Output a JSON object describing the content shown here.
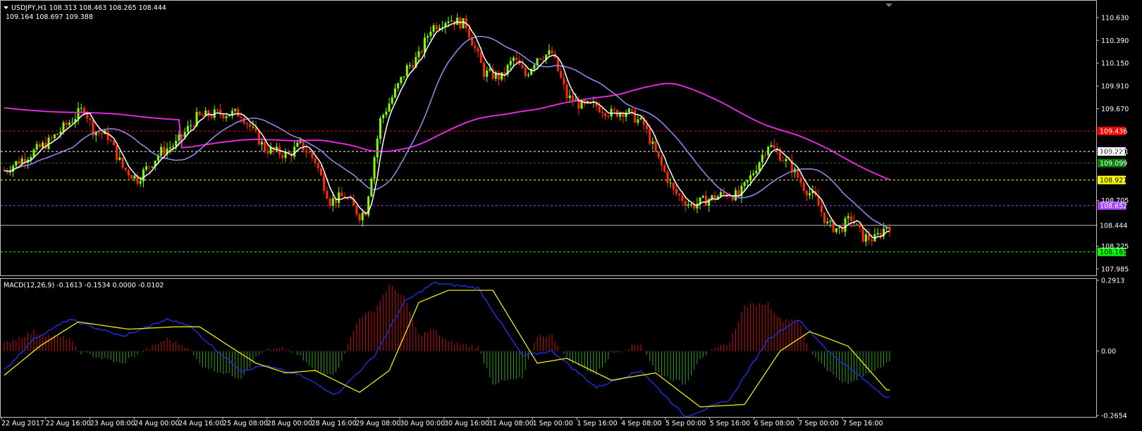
{
  "header": {
    "symbol_line": "USDJPY,H1  108.313 108.463 108.265 108.444",
    "ma_line": "109.164 108.697 109.388",
    "macd_label": "MACD(12,26,9) -0.1613 -0.1534 0.0000 -0.0102"
  },
  "colors": {
    "background": "#000000",
    "bull": "#7fff00",
    "bear": "#ff2a00",
    "white_ma": "#ffffff",
    "slow_ma": "#9a8cf0",
    "magenta_ma": "#e02ad6",
    "macd_line": "#1e2ed8",
    "signal_line": "#ffff00",
    "hist_pos": "#c81010",
    "hist_neg": "#2fa01a"
  },
  "chart_data": [
    {
      "type": "candlestick",
      "title": "USDJPY,H1",
      "ylim": [
        107.94,
        110.77
      ],
      "y_ticks": [
        "110.630",
        "110.390",
        "110.150",
        "109.910",
        "109.670",
        "109.221",
        "108.705",
        "108.444",
        "108.225",
        "107.985"
      ],
      "y_tick_values": [
        110.63,
        110.39,
        110.15,
        109.91,
        109.67,
        109.221,
        108.705,
        108.444,
        108.225,
        107.985
      ],
      "x_ticks": [
        "22 Aug 2017",
        "22 Aug 16:00",
        "23 Aug 08:00",
        "24 Aug 00:00",
        "24 Aug 16:00",
        "25 Aug 08:00",
        "28 Aug 00:00",
        "28 Aug 16:00",
        "29 Aug 08:00",
        "30 Aug 00:00",
        "30 Aug 16:00",
        "31 Aug 08:00",
        "1 Sep 00:00",
        "1 Sep 16:00",
        "4 Sep 08:00",
        "5 Sep 00:00",
        "5 Sep 16:00",
        "6 Sep 08:00",
        "7 Sep 00:00",
        "7 Sep 16:00"
      ],
      "price_path": {
        "candle_index": [
          0,
          15,
          27,
          30,
          35,
          40,
          45,
          53,
          58,
          65,
          72,
          80,
          88,
          96,
          100,
          105,
          110,
          115,
          120,
          122,
          127,
          132,
          136,
          140,
          144,
          150,
          156,
          162,
          168,
          172,
          176,
          180,
          185,
          190,
          195,
          200,
          205,
          210,
          216,
          220,
          226,
          232,
          238,
          244,
          248,
          252,
          258,
          262,
          266,
          270,
          274,
          278,
          282,
          286,
          290,
          294,
          298
        ],
        "close": [
          109.02,
          109.32,
          109.68,
          109.45,
          109.38,
          109.05,
          108.93,
          109.22,
          109.3,
          109.58,
          109.62,
          109.62,
          109.25,
          109.18,
          109.3,
          109.12,
          108.7,
          108.75,
          108.55,
          108.6,
          109.55,
          109.85,
          110.1,
          110.22,
          110.52,
          110.62,
          110.55,
          110.05,
          110.0,
          110.2,
          110.02,
          110.22,
          110.25,
          109.8,
          109.7,
          109.7,
          109.62,
          109.65,
          109.5,
          109.2,
          108.8,
          108.65,
          108.72,
          108.78,
          108.75,
          108.95,
          109.3,
          109.18,
          109.05,
          108.85,
          108.72,
          108.45,
          108.4,
          108.52,
          108.32,
          108.3,
          108.44
        ]
      },
      "horizontal_lines": [
        {
          "label": "109.436",
          "value": 109.436,
          "color": "#ff0000",
          "style": "dashed"
        },
        {
          "label": "109.221",
          "value": 109.221,
          "color": "#ffffff",
          "style": "dashed"
        },
        {
          "label": "109.099",
          "value": 109.099,
          "color": "#008000",
          "style": "dashed"
        },
        {
          "label": "108.921",
          "value": 108.921,
          "color": "#ffff00",
          "style": "dashed"
        },
        {
          "label": "108.652",
          "value": 108.652,
          "color": "#a040ff",
          "style": "dashed"
        },
        {
          "label": "108.444",
          "value": 108.444,
          "color": "#c0c0c0",
          "style": "solid"
        },
        {
          "label": "108.165",
          "value": 108.165,
          "color": "#00ff00",
          "style": "dashed"
        }
      ],
      "moving_averages": [
        "white fast MA",
        "lavender slow MA",
        "magenta long MA"
      ]
    },
    {
      "type": "macd_histogram",
      "title": "MACD(12,26,9)",
      "ylim": [
        -0.2654,
        0.2913
      ],
      "y_ticks": [
        "0.2913",
        "0.00",
        "-0.2654"
      ],
      "y_tick_values": [
        0.2913,
        0.0,
        -0.2654
      ],
      "series": [
        {
          "name": "MACD",
          "anchor_index": [
            0,
            10,
            22,
            40,
            55,
            62,
            72,
            80,
            88,
            100,
            112,
            125,
            135,
            145,
            160,
            175,
            185,
            200,
            215,
            230,
            245,
            258,
            268,
            280,
            298
          ],
          "values": [
            -0.08,
            0.05,
            0.13,
            0.06,
            0.13,
            0.11,
            0.0,
            -0.08,
            -0.06,
            -0.1,
            -0.18,
            -0.02,
            0.2,
            0.28,
            0.26,
            -0.02,
            0.0,
            -0.15,
            -0.08,
            -0.27,
            -0.2,
            0.05,
            0.13,
            -0.02,
            -0.19
          ]
        },
        {
          "name": "Signal",
          "anchor_index": [
            0,
            12,
            25,
            42,
            58,
            66,
            76,
            85,
            95,
            105,
            120,
            130,
            140,
            150,
            165,
            180,
            190,
            205,
            220,
            235,
            250,
            262,
            272,
            285,
            298
          ],
          "values": [
            -0.1,
            0.02,
            0.12,
            0.09,
            0.1,
            0.1,
            0.02,
            -0.05,
            -0.09,
            -0.08,
            -0.17,
            -0.08,
            0.2,
            0.25,
            0.25,
            -0.05,
            -0.03,
            -0.12,
            -0.09,
            -0.23,
            -0.22,
            0.0,
            0.08,
            0.02,
            -0.16
          ]
        }
      ]
    }
  ]
}
